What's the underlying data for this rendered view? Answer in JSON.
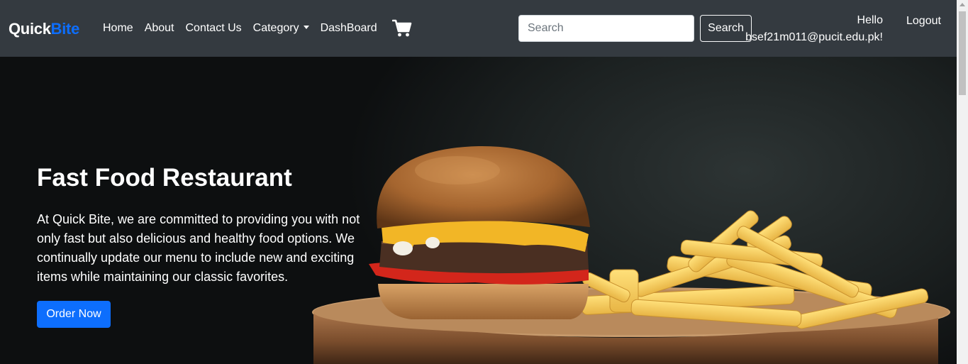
{
  "brand": {
    "part1": "Quick",
    "part2": "Bite"
  },
  "nav": {
    "home": "Home",
    "about": "About",
    "contact": "Contact Us",
    "category": "Category",
    "dashboard": "DashBoard"
  },
  "search": {
    "placeholder": "Search",
    "value": "",
    "button": "Search"
  },
  "user": {
    "greeting": "Hello",
    "email": "bsef21m011@pucit.edu.pk!",
    "logout": "Logout"
  },
  "hero": {
    "title": "Fast Food Restaurant",
    "text": "At Quick Bite, we are committed to providing you with not only fast but also delicious and healthy food options. We continually update our menu to include new and exciting items while maintaining our classic favorites.",
    "button": "Order Now"
  },
  "colors": {
    "navbar": "#343a40",
    "accent": "#0d6efd",
    "hero_bg": "#0c0e0f"
  },
  "icons": {
    "cart": "shopping-cart-icon",
    "dropdown": "caret-down-icon"
  }
}
